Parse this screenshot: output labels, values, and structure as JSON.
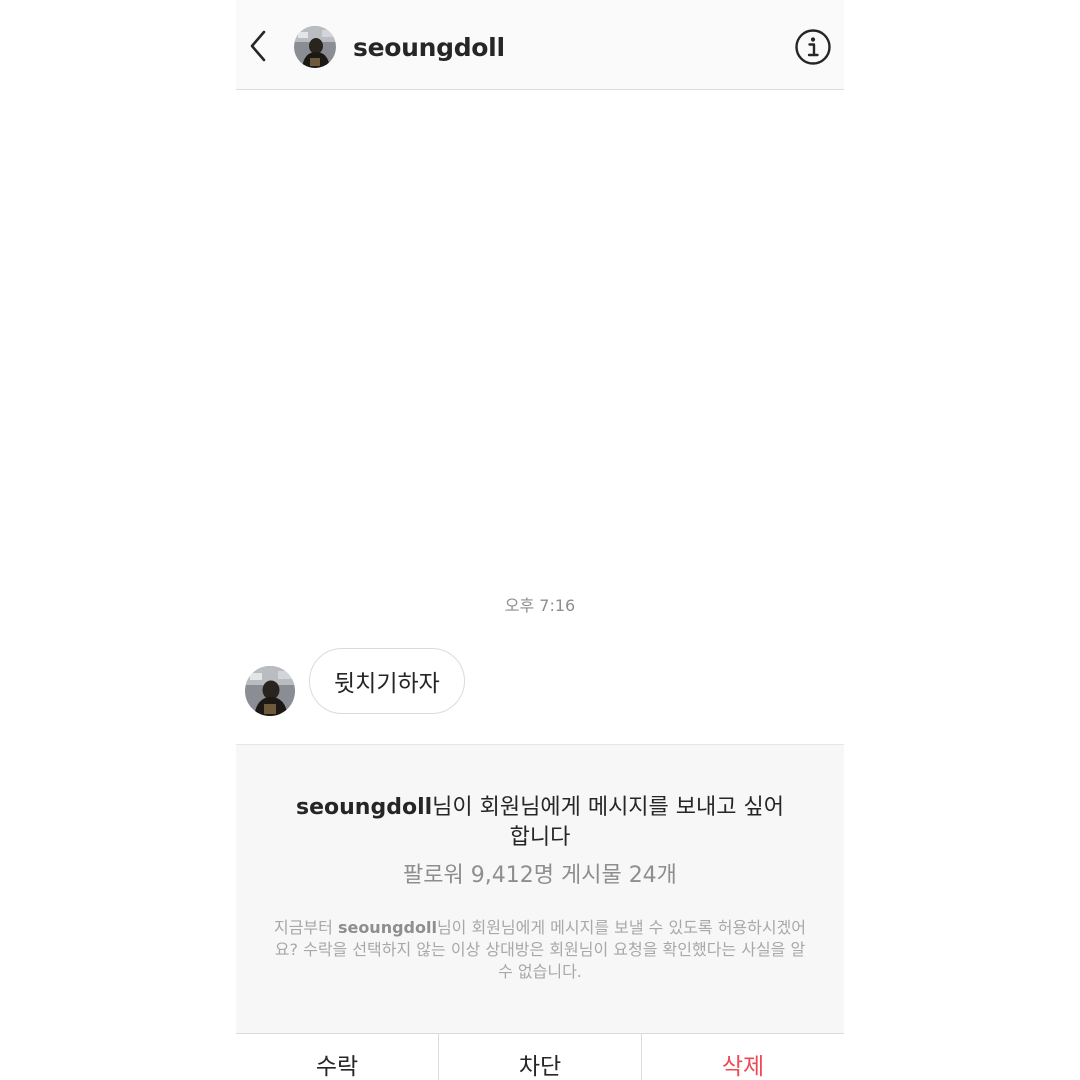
{
  "header": {
    "title": "seoungdoll",
    "back_icon": "chevron-left-icon",
    "info_icon": "info-icon"
  },
  "chat": {
    "timestamp": "오후 7:16",
    "messages": [
      {
        "text": "뒷치기하자"
      }
    ]
  },
  "request": {
    "title_user": "seoungdoll",
    "title_suffix": "님이 회원님에게 메시지를 보내고 싶어 합니다",
    "stats": "팔로워 9,412명 게시물 24개",
    "desc_prefix": "지금부터 ",
    "desc_user": "seoungdoll",
    "desc_suffix": "님이 회원님에게 메시지를 보낼 수 있도록 허용하시겠어요? 수락을 선택하지 않는 이상 상대방은 회원님이 요청을 확인했다는 사실을 알 수 없습니다."
  },
  "actions": {
    "accept": "수락",
    "block": "차단",
    "delete": "삭제"
  },
  "colors": {
    "danger": "#ed4956",
    "muted": "#8e8e8e",
    "panel_bg": "#f7f7f7"
  }
}
